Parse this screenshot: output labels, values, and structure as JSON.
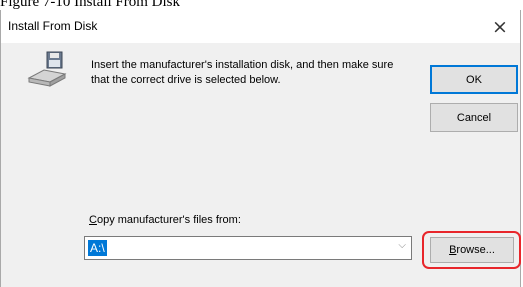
{
  "caption": "Figure 7-10 Install From Disk",
  "dialog": {
    "title": "Install From Disk",
    "close_glyph": "×",
    "icon": "floppy-disk-drive-icon",
    "instruction": "Insert the manufacturer's installation disk, and then make sure that the correct drive is selected below.",
    "ok_label": "OK",
    "cancel_label": "Cancel",
    "copy_label_accel": "C",
    "copy_label_rest": "opy manufacturer's files from:",
    "path_value": "A:\\",
    "combo_chevron": "⌵",
    "browse_label_accel": "B",
    "browse_label_rest": "rowse...",
    "annotation_color": "#e8262b"
  }
}
